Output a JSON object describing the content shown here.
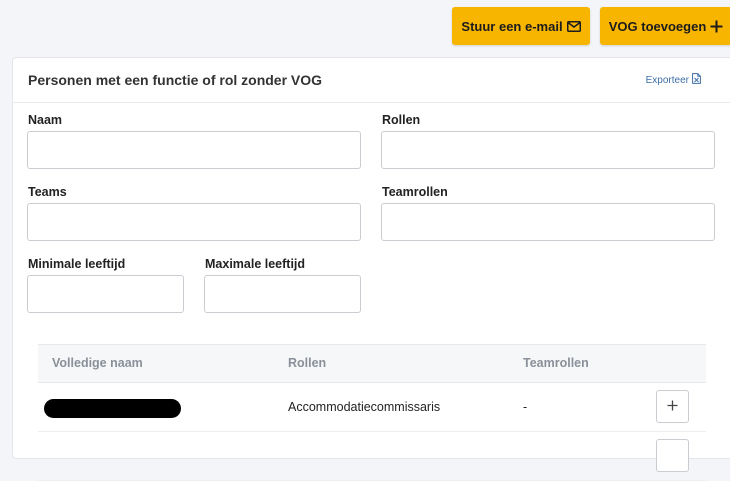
{
  "toolbar": {
    "email_button": "Stuur een e-mail",
    "email_icon": "envelope-icon",
    "add_vog_button": "VOG toevoegen",
    "add_vog_icon": "plus-icon"
  },
  "card": {
    "title": "Personen met een functie of rol zonder VOG",
    "export_label": "Exporteer",
    "export_icon": "spreadsheet-file-icon"
  },
  "filters": {
    "naam": {
      "label": "Naam",
      "value": ""
    },
    "rollen": {
      "label": "Rollen",
      "value": ""
    },
    "teams": {
      "label": "Teams",
      "value": ""
    },
    "teamrollen": {
      "label": "Teamrollen",
      "value": ""
    },
    "min_age": {
      "label": "Minimale leeftijd",
      "value": ""
    },
    "max_age": {
      "label": "Maximale leeftijd",
      "value": ""
    }
  },
  "table": {
    "columns": [
      "Volledige naam",
      "Rollen",
      "Teamrollen"
    ],
    "rows": [
      {
        "name_redacted": true,
        "rollen": "Accommodatiecommissaris",
        "teamrollen": "-",
        "action_icon": "plus-icon"
      }
    ]
  },
  "colors": {
    "accent": "#f7b500",
    "link": "#3f6fa8",
    "background": "#f4f5f8"
  }
}
